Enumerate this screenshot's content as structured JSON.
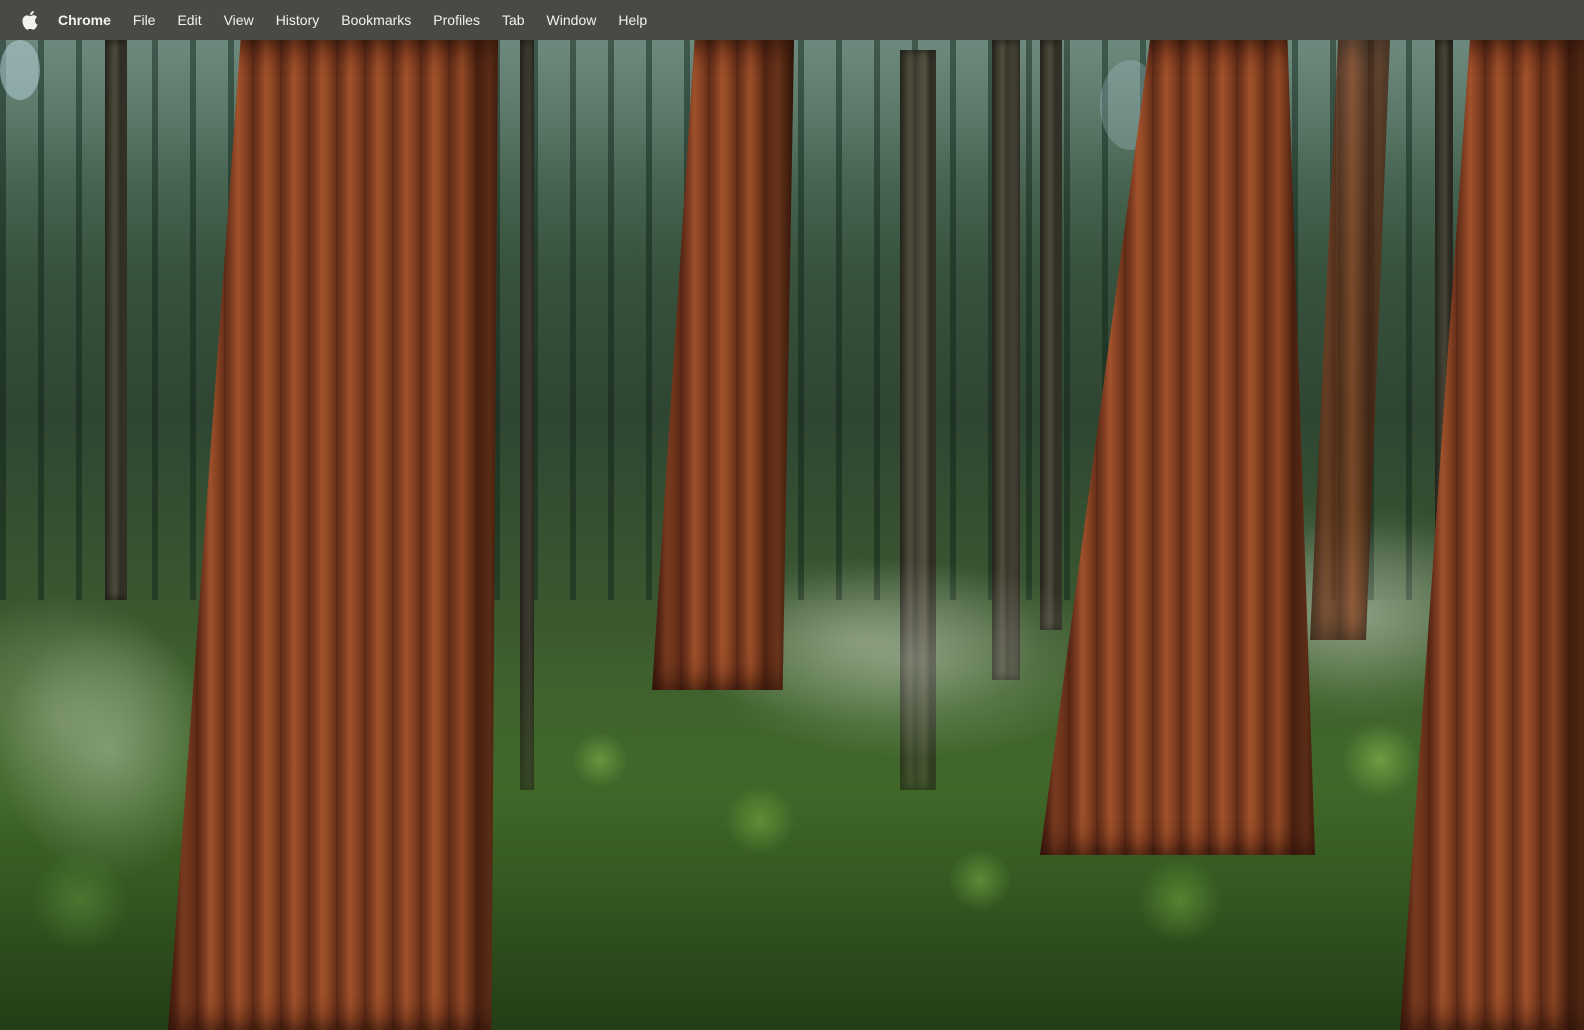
{
  "menubar": {
    "apple_icon": "apple-logo-icon",
    "app_name": "Chrome",
    "items": [
      {
        "label": "File"
      },
      {
        "label": "Edit"
      },
      {
        "label": "View"
      },
      {
        "label": "History"
      },
      {
        "label": "Bookmarks"
      },
      {
        "label": "Profiles"
      },
      {
        "label": "Tab"
      },
      {
        "label": "Window"
      },
      {
        "label": "Help"
      }
    ],
    "background_color": "#4a4a44",
    "text_color": "#f2f2ee"
  },
  "desktop": {
    "wallpaper": "sequoia-forest"
  }
}
